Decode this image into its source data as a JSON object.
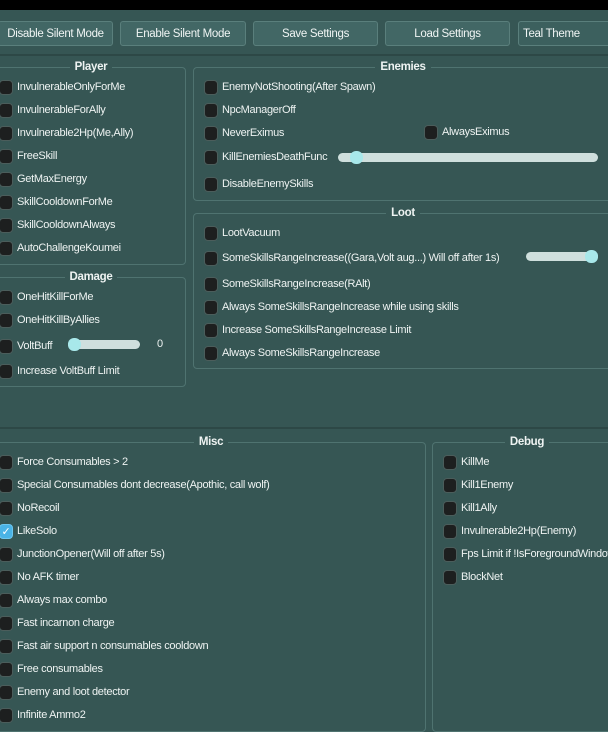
{
  "toolbar": {
    "disable_silent": "Disable Silent Mode",
    "enable_silent": "Enable Silent Mode",
    "save": "Save Settings",
    "load": "Load Settings",
    "theme": "Teal Theme"
  },
  "player": {
    "title": "Player",
    "items": [
      "InvulnerableOnlyForMe",
      "InvulnerableForAlly",
      "Invulnerable2Hp(Me,Ally)",
      "FreeSkill",
      "GetMaxEnergy",
      "SkillCooldownForMe",
      "SkillCooldownAlways",
      "AutoChallengeKoumei"
    ]
  },
  "enemies": {
    "title": "Enemies",
    "items": [
      "EnemyNotShooting(After Spawn)",
      "NpcManagerOff",
      "NeverEximus",
      "KillEnemiesDeathFunc",
      "DisableEnemySkills"
    ],
    "always_eximus": "AlwaysEximus",
    "kill_slider": 0.05
  },
  "loot": {
    "title": "Loot",
    "items": [
      "LootVacuum",
      "SomeSkillsRangeIncrease((Gara,Volt aug...) Will off after 1s)",
      "SomeSkillsRangeIncrease(RAlt)",
      "Always SomeSkillsRangeIncrease while using skills",
      "Increase SomeSkillsRangeIncrease Limit",
      "Always SomeSkillsRangeIncrease"
    ],
    "range_slider": 1.0
  },
  "damage": {
    "title": "Damage",
    "items": [
      "OneHitKillForMe",
      "OneHitKillByAllies",
      "VoltBuff",
      "Increase VoltBuff Limit"
    ],
    "voltbuff_value": "0"
  },
  "misc": {
    "title": "Misc",
    "items": [
      "Force Consumables > 2",
      "Special Consumables dont decrease(Apothic, call wolf)",
      "NoRecoil",
      "LikeSolo",
      "JunctionOpener(Will off after 5s)",
      "No AFK timer",
      "Always max combo",
      "Fast incarnon charge",
      "Fast air support n consumables cooldown",
      "Free consumables",
      "Enemy and loot detector",
      "Infinite Ammo2"
    ],
    "checked": [
      3
    ]
  },
  "debug": {
    "title": "Debug",
    "items": [
      "KillMe",
      "Kill1Enemy",
      "Kill1Ally",
      "Invulnerable2Hp(Enemy)",
      "Fps Limit if !IsForegroundWindow",
      "BlockNet"
    ]
  }
}
